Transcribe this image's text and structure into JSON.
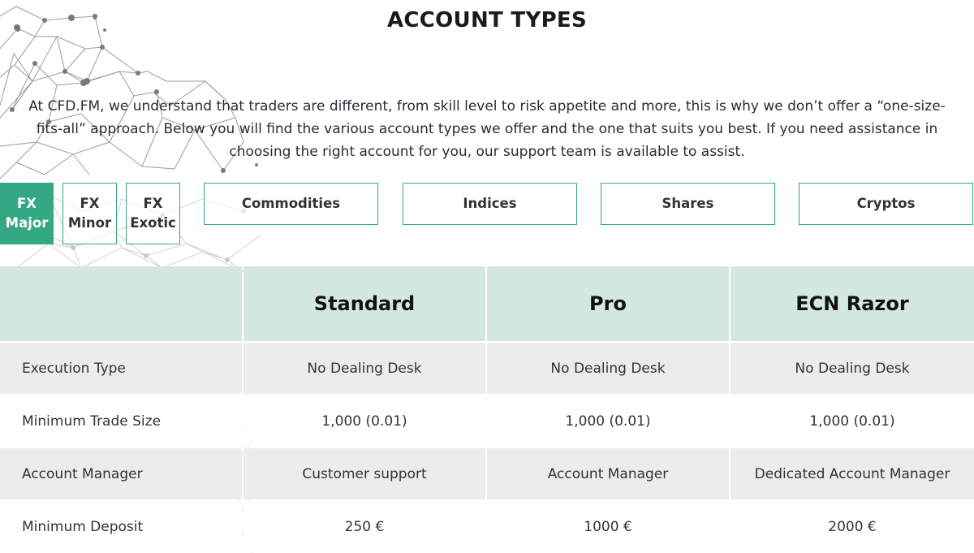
{
  "header": {
    "title": "ACCOUNT TYPES"
  },
  "intro": {
    "text": "At CFD.FM, we understand that traders are different, from skill level to risk appetite and more, this is why we don’t offer a “one-size-fits-all” approach. Below you will find the various account types we offer and the one that suits you best. If you need assistance in choosing the right account for you, our support team is available to assist."
  },
  "tabs": [
    {
      "line1": "FX",
      "line2": "Major",
      "active": true
    },
    {
      "line1": "FX",
      "line2": "Minor",
      "active": false
    },
    {
      "line1": "FX",
      "line2": "Exotic",
      "active": false
    },
    {
      "label": "Commodities",
      "active": false
    },
    {
      "label": "Indices",
      "active": false
    },
    {
      "label": "Shares",
      "active": false
    },
    {
      "label": "Cryptos",
      "active": false
    }
  ],
  "table": {
    "columns": [
      "",
      "Standard",
      "Pro",
      "ECN Razor"
    ],
    "rows": [
      {
        "label": "Execution Type",
        "values": [
          "No Dealing Desk",
          "No Dealing Desk",
          "No Dealing Desk"
        ]
      },
      {
        "label": "Minimum Trade Size",
        "values": [
          "1,000 (0.01)",
          "1,000 (0.01)",
          "1,000 (0.01)"
        ]
      },
      {
        "label": "Account Manager",
        "values": [
          "Customer support",
          "Account Manager",
          "Dedicated Account Manager"
        ]
      },
      {
        "label": "Minimum Deposit",
        "values": [
          "250 €",
          "1000 €",
          "2000 €"
        ]
      }
    ]
  },
  "colors": {
    "accent": "#34a882",
    "header_bg": "#d3e9e0",
    "row_grey": "#ececec"
  }
}
